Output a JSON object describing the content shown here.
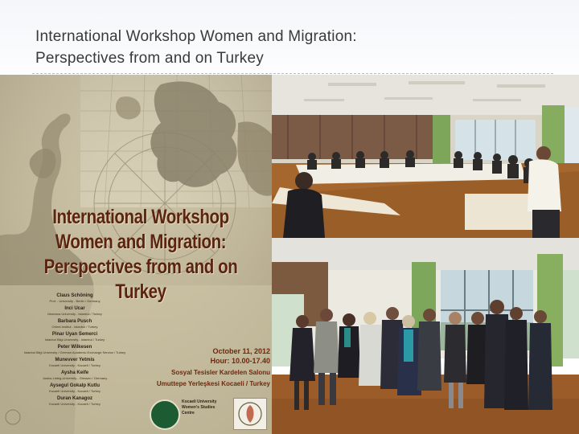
{
  "slide": {
    "title_line1": "International Workshop Women and Migration:",
    "title_line2": "Perspectives from and on Turkey"
  },
  "poster": {
    "heading_line1": "International Workshop",
    "heading_line2": "Women and Migration:",
    "heading_line3": "Perspectives from and on Turkey",
    "speakers": [
      {
        "name": "Claus Schöning",
        "affiliation": "Prof. - University - Berlin / Germany"
      },
      {
        "name": "Inci Ucar",
        "affiliation": "Marmara University - Istanbul / Turkey"
      },
      {
        "name": "Barbara Pusch",
        "affiliation": "Orient-Institut - Istanbul / Turkey"
      },
      {
        "name": "Pinar Uyan Semerci",
        "affiliation": "Istanbul Bilgi University - Istanbul / Turkey"
      },
      {
        "name": "Peter Wilkesen",
        "affiliation": "Istanbul Bilgi University / German Academic Exchange Service / Turkey"
      },
      {
        "name": "Munevver Yetmis",
        "affiliation": "Kocaeli University - Kocaeli / Turkey"
      },
      {
        "name": "Aysha Keife",
        "affiliation": "Justus-Liebig-University - Giessen / Germany"
      },
      {
        "name": "Aysegul Gokalp Kutlu",
        "affiliation": "Kocaeli University - Kocaeli / Turkey"
      },
      {
        "name": "Duran Kanagoz",
        "affiliation": "Kocaeli University - Kocaeli / Turkey"
      }
    ],
    "date": "October 11, 2012",
    "hour": "Hour: 10.00-17.40",
    "venue_line1": "Sosyal Tesisler Kardelen Salonu",
    "venue_line2": "Umuttepe Yerleşkesi Kocaeli / Turkey",
    "logo_line1": "Kocaeli University",
    "logo_line2": "Women's Studies",
    "logo_line3": "Centre"
  },
  "colors": {
    "title_text": "#3a3a3a",
    "poster_heading": "#5a2410",
    "poster_background": "#c8bea1"
  },
  "icons": {
    "poster_art": "woman-silhouette-and-map",
    "logo_left": "kocaeli-university-seal",
    "logo_right": "womens-studies-centre-emblem"
  }
}
